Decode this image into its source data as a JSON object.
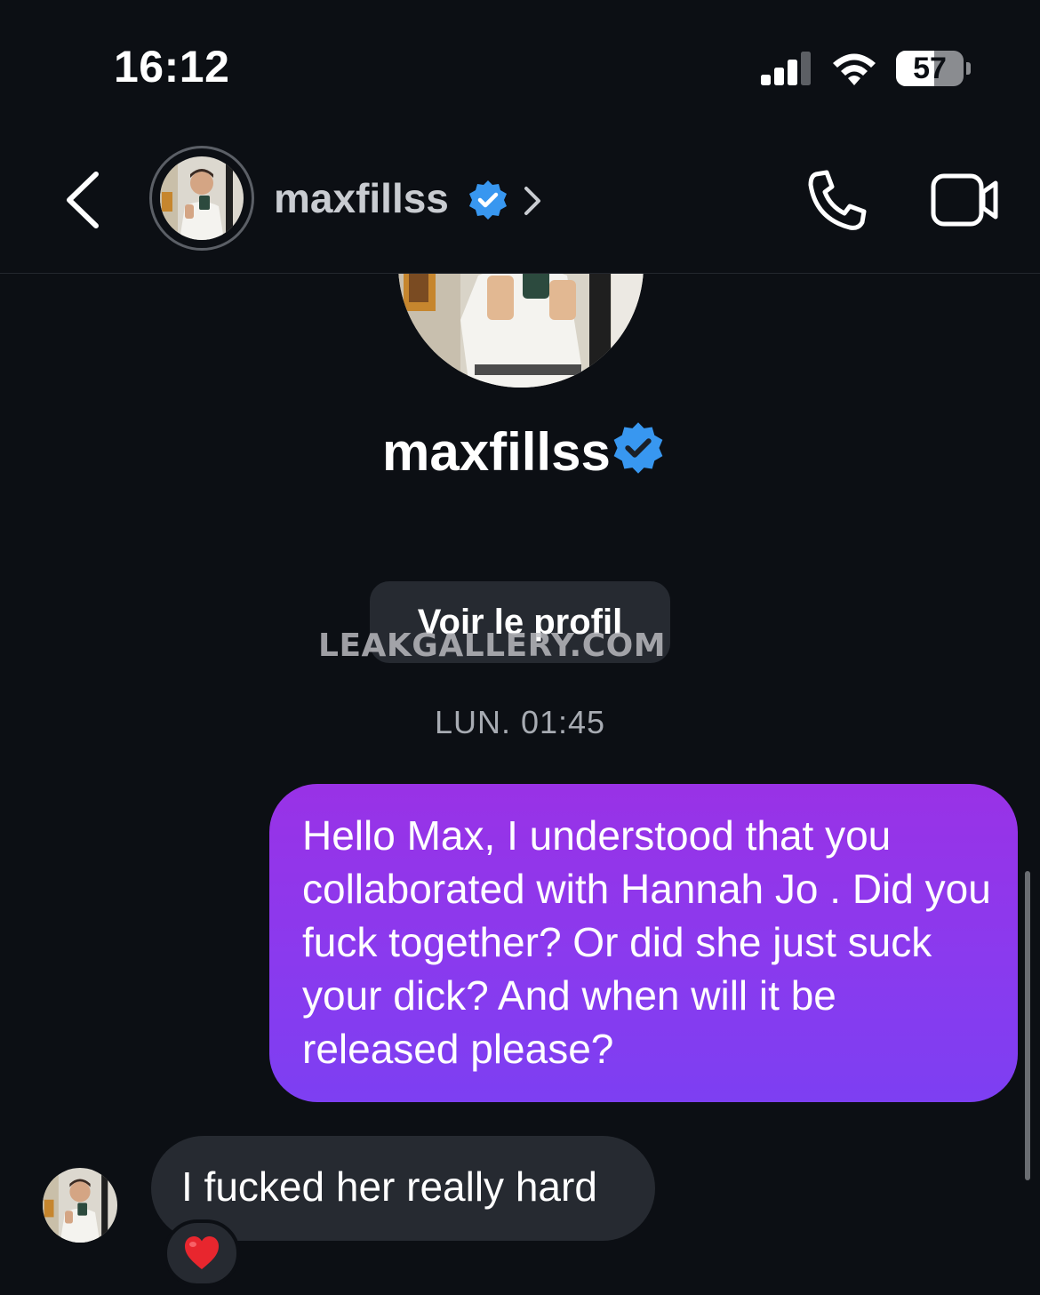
{
  "status_bar": {
    "time": "16:12",
    "battery_level": "57",
    "icons": [
      "cellular-signal-icon",
      "wifi-icon",
      "battery-icon"
    ]
  },
  "header": {
    "username": "maxfillss",
    "verified": true,
    "icons": [
      "back-chevron-icon",
      "verified-badge-icon",
      "chevron-right-icon",
      "phone-icon",
      "video-camera-icon"
    ]
  },
  "profile": {
    "username": "maxfillss",
    "verified": true,
    "view_profile_label": "Voir le profil"
  },
  "watermark": "LEAKGALLERY.COM",
  "conversation": {
    "timestamp": "LUN. 01:45",
    "messages": [
      {
        "direction": "outgoing",
        "text": "Hello Max, I understood that you collaborated with Hannah Jo . Did you fuck together? Or did she just suck your dick? And when will it be released please?"
      },
      {
        "direction": "incoming",
        "text": "I fucked her really hard",
        "reaction": "❤️"
      }
    ]
  },
  "colors": {
    "background": "#0c0f14",
    "outgoing_bubble": "#8a3aee",
    "incoming_bubble": "#262a31",
    "verified_blue": "#3897f0"
  }
}
